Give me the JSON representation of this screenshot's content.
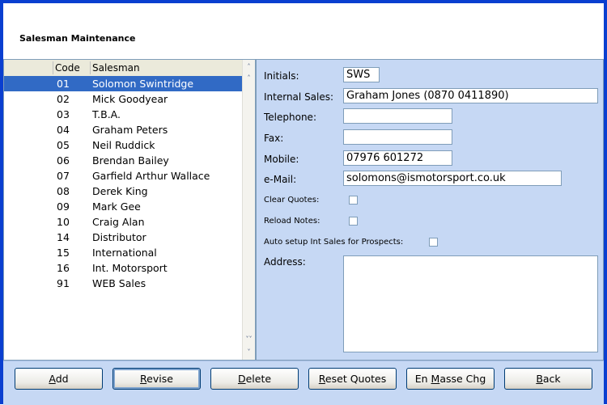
{
  "window": {
    "title": "Salesman Maintenance"
  },
  "list": {
    "headers": {
      "code": "Code",
      "salesman": "Salesman"
    },
    "rows": [
      {
        "code": "01",
        "name": "Solomon Swintridge",
        "selected": true
      },
      {
        "code": "02",
        "name": "Mick Goodyear"
      },
      {
        "code": "03",
        "name": "T.B.A."
      },
      {
        "code": "04",
        "name": "Graham Peters"
      },
      {
        "code": "05",
        "name": "Neil Ruddick"
      },
      {
        "code": "06",
        "name": "Brendan Bailey"
      },
      {
        "code": "07",
        "name": "Garfield Arthur Wallace"
      },
      {
        "code": "08",
        "name": "Derek King"
      },
      {
        "code": "09",
        "name": "Mark Gee"
      },
      {
        "code": "10",
        "name": "Craig Alan"
      },
      {
        "code": "14",
        "name": "Distributor"
      },
      {
        "code": "15",
        "name": "International"
      },
      {
        "code": "16",
        "name": "Int. Motorsport"
      },
      {
        "code": "91",
        "name": "WEB Sales"
      }
    ]
  },
  "form": {
    "initials": {
      "label": "Initials:",
      "value": "SWS"
    },
    "internal_sales": {
      "label": "Internal Sales:",
      "value": "Graham Jones (0870 0411890)"
    },
    "telephone": {
      "label": "Telephone:",
      "value": ""
    },
    "fax": {
      "label": "Fax:",
      "value": ""
    },
    "mobile": {
      "label": "Mobile:",
      "value": "07976 601272"
    },
    "email": {
      "label": "e-Mail:",
      "value": "solomons@ismotorsport.co.uk"
    },
    "clear_quotes": {
      "label": "Clear Quotes:"
    },
    "reload_notes": {
      "label": "Reload Notes:"
    },
    "auto_setup": {
      "label": "Auto setup Int Sales for Prospects:"
    },
    "address": {
      "label": "Address:",
      "value": ""
    }
  },
  "buttons": {
    "add": {
      "first": "A",
      "rest": "dd"
    },
    "revise": {
      "first": "R",
      "rest": "evise"
    },
    "delete": {
      "first": "D",
      "rest": "elete"
    },
    "reset_quotes": {
      "first": "R",
      "rest": "eset Quotes"
    },
    "en_masse": {
      "pre": "En ",
      "first": "M",
      "rest": "asse Chg"
    },
    "back": {
      "first": "B",
      "rest": "ack"
    }
  }
}
